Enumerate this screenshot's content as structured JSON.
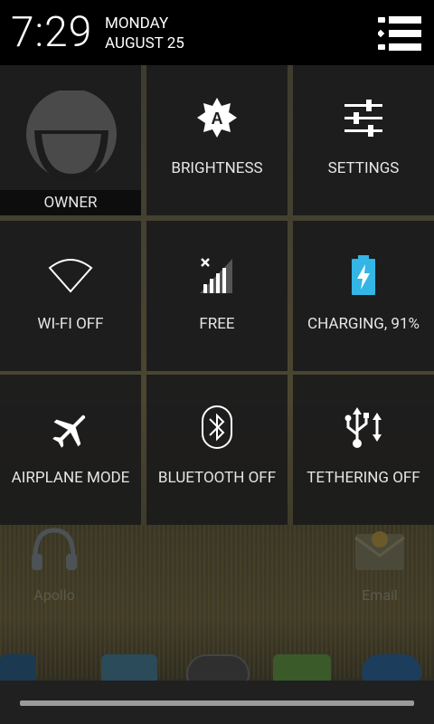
{
  "status": {
    "time": "7:29",
    "day": "MONDAY",
    "date": "AUGUST 25"
  },
  "background_apps": [
    {
      "label": "Apollo",
      "icon": "headphones-icon"
    },
    {
      "label": "Email",
      "icon": "email-icon"
    }
  ],
  "tiles": {
    "owner": {
      "label": "OWNER",
      "icon": "avatar-icon"
    },
    "brightness": {
      "label": "BRIGHTNESS",
      "icon": "brightness-auto-icon"
    },
    "settings": {
      "label": "SETTINGS",
      "icon": "settings-sliders-icon"
    },
    "wifi": {
      "label": "WI-FI OFF",
      "icon": "wifi-icon"
    },
    "signal": {
      "label": "FREE",
      "icon": "signal-icon"
    },
    "battery": {
      "label": "CHARGING, 91%",
      "icon": "battery-charging-icon",
      "level": 0.91,
      "color": "#33b5e5"
    },
    "airplane": {
      "label": "AIRPLANE MODE",
      "icon": "airplane-icon"
    },
    "bluetooth": {
      "label": "BLUETOOTH OFF",
      "icon": "bluetooth-icon"
    },
    "tethering": {
      "label": "TETHERING OFF",
      "icon": "usb-icon"
    }
  },
  "colors": {
    "accent": "#33b5e5",
    "tile_bg": "#1c1c1c",
    "header_bg": "#000000"
  }
}
